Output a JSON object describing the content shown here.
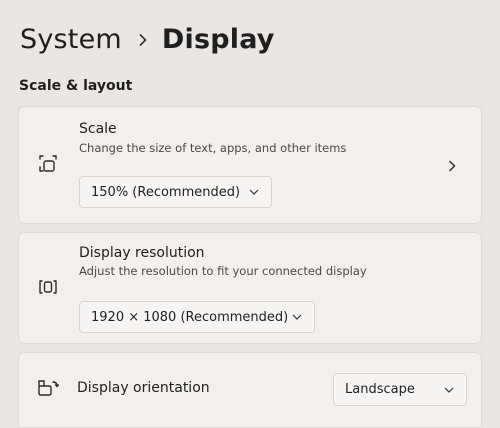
{
  "breadcrumb": {
    "parent": "System",
    "separator_icon": "chevron-right-icon",
    "current": "Display"
  },
  "section": {
    "title": "Scale & layout"
  },
  "scale": {
    "icon": "scale-icon",
    "title": "Scale",
    "description": "Change the size of text, apps, and other items",
    "value": "150% (Recommended)",
    "expand_icon": "chevron-right-icon"
  },
  "resolution": {
    "icon": "resolution-icon",
    "title": "Display resolution",
    "description": "Adjust the resolution to fit your connected display",
    "value": "1920 × 1080 (Recommended)"
  },
  "orientation": {
    "icon": "orientation-icon",
    "title": "Display orientation",
    "value": "Landscape"
  }
}
